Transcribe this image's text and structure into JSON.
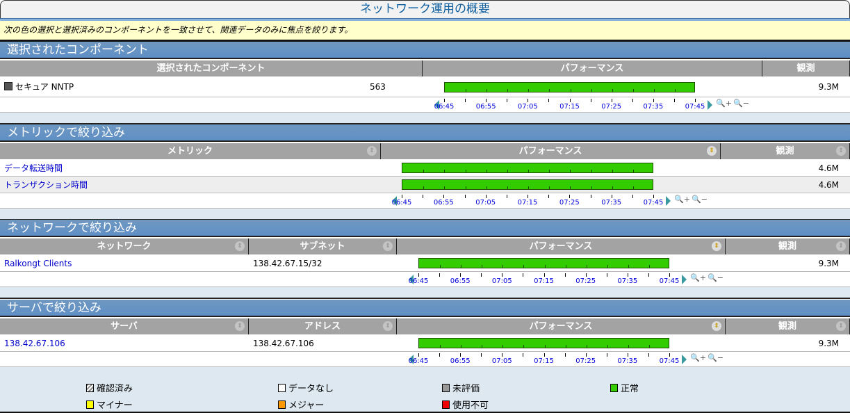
{
  "title": "ネットワーク運用の概要",
  "info": "次の色の選択と選択済みのコンポーネントを一致させて、関連データのみに焦点を絞ります。",
  "colors": {
    "bar": "#33cc00",
    "section": "#6596c6",
    "header": "#a3a3a3",
    "link": "#0000cc"
  },
  "time_labels": [
    "06:45",
    "06:55",
    "07:05",
    "07:15",
    "07:25",
    "07:35",
    "07:45"
  ],
  "sections": [
    {
      "title": "選択されたコンポーネント",
      "columns": [
        "選択されたコンポーネント",
        "パフォーマンス",
        "観測"
      ],
      "rows": [
        {
          "cells": [
            "セキュア NNTP"
          ],
          "count": "563",
          "performance": 1.0,
          "observed": "9.3M"
        }
      ]
    },
    {
      "title": "メトリックで絞り込み",
      "columns": [
        "メトリック",
        "パフォーマンス",
        "観測"
      ],
      "rows": [
        {
          "cells": [
            "データ転送時間"
          ],
          "performance": 1.0,
          "observed": "4.6M"
        },
        {
          "cells": [
            "トランザクション時間"
          ],
          "performance": 1.0,
          "observed": "4.6M"
        }
      ]
    },
    {
      "title": "ネットワークで絞り込み",
      "columns": [
        "ネットワーク",
        "サブネット",
        "パフォーマンス",
        "観測"
      ],
      "rows": [
        {
          "cells": [
            "Ralkongt Clients",
            "138.42.67.15/32"
          ],
          "performance": 1.0,
          "observed": "9.3M"
        }
      ]
    },
    {
      "title": "サーバで絞り込み",
      "columns": [
        "サーバ",
        "アドレス",
        "パフォーマンス",
        "観測"
      ],
      "rows": [
        {
          "cells": [
            "138.42.67.106",
            "138.42.67.106"
          ],
          "performance": 1.0,
          "observed": "9.3M"
        }
      ]
    }
  ],
  "legend": [
    {
      "label": "確認済み",
      "color": "hatch"
    },
    {
      "label": "データなし",
      "color": "#ffffff"
    },
    {
      "label": "未評価",
      "color": "#999999"
    },
    {
      "label": "正常",
      "color": "#33cc00"
    },
    {
      "label": "マイナー",
      "color": "#ffff00"
    },
    {
      "label": "メジャー",
      "color": "#ff9900"
    },
    {
      "label": "使用不可",
      "color": "#ee0000"
    }
  ]
}
